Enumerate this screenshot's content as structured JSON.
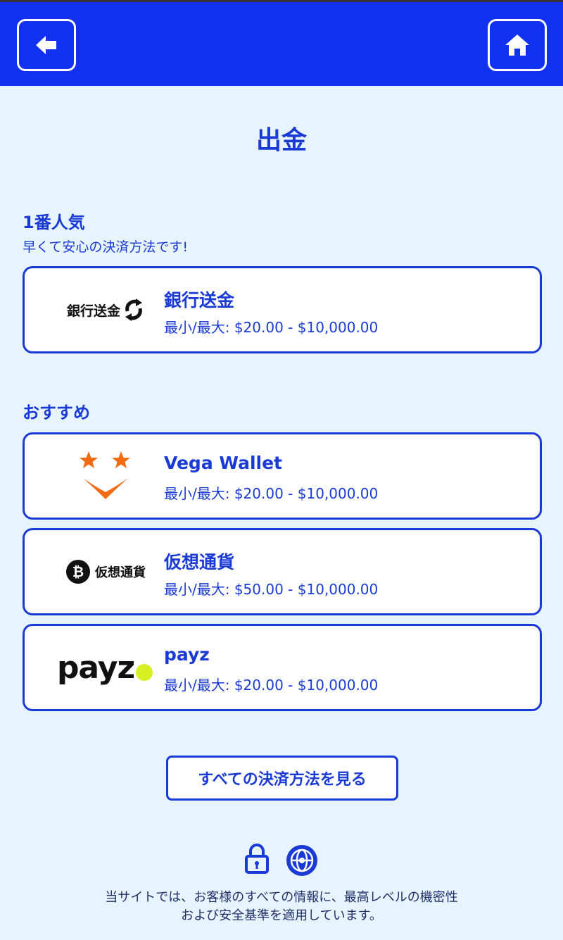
{
  "page_title": "出金",
  "sections": [
    {
      "title": "1番人気",
      "subtitle": "早くて安心の決済方法です!"
    },
    {
      "title": "おすすめ"
    }
  ],
  "methods": [
    {
      "name": "銀行送金",
      "range": "最小/最大: $20.00 - $10,000.00",
      "logo_text": "銀行送金",
      "icon": "refresh-arrows-icon"
    },
    {
      "name": "Vega Wallet",
      "range": "最小/最大: $20.00 - $10,000.00",
      "icon": "vega-stars-icon"
    },
    {
      "name": "仮想通貨",
      "range": "最小/最大: $50.00 - $10,000.00",
      "logo_text": "仮想通貨",
      "icon": "bitcoin-icon"
    },
    {
      "name": "payz",
      "range": "最小/最大: $20.00 - $10,000.00",
      "logo_text": "payz",
      "icon": "payz-dot-icon"
    }
  ],
  "all_methods_button": "すべての決済方法を見る",
  "footer": {
    "line1": "当サイトでは、お客様のすべての情報に、最高レベルの機密性",
    "line2": "および安全基準を適用しています。"
  },
  "colors": {
    "header": "#1230f0",
    "accent": "#1a3ad6",
    "background": "#e8f4fd",
    "vega_orange": "#f26a12",
    "payz_dot": "#d7f021"
  }
}
